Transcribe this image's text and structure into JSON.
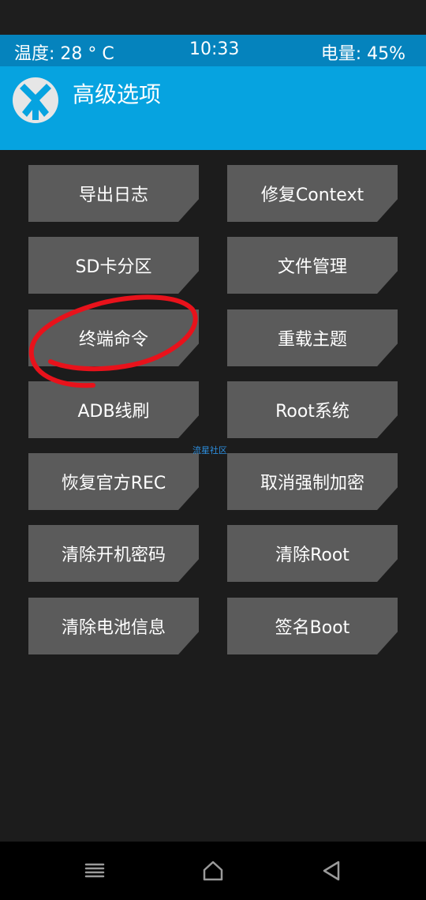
{
  "status": {
    "temperature": "温度: 28 ° C",
    "time": "10:33",
    "battery": "电量: 45%"
  },
  "header": {
    "logo_icon": "twrp-logo-icon",
    "title": "高级选项"
  },
  "buttons": {
    "export_log": "导出日志",
    "fix_context": "修复Context",
    "sd_partition": "SD卡分区",
    "file_manager": "文件管理",
    "terminal": "终端命令",
    "reload_theme": "重载主题",
    "adb_flash": "ADB线刷",
    "root_system": "Root系统",
    "restore_official_rec": "恢复官方REC",
    "cancel_force_encrypt": "取消强制加密",
    "clear_boot_password": "清除开机密码",
    "clear_root": "清除Root",
    "clear_battery_info": "清除电池信息",
    "sign_boot": "签名Boot"
  },
  "watermark": "流星社区",
  "colors": {
    "status_bar": "#0583bd",
    "header": "#06a3e0",
    "button": "#5b5b5b",
    "annotation": "#e8121b"
  },
  "nav": {
    "menu_icon": "menu-icon",
    "home_icon": "home-icon",
    "back_icon": "back-icon"
  }
}
